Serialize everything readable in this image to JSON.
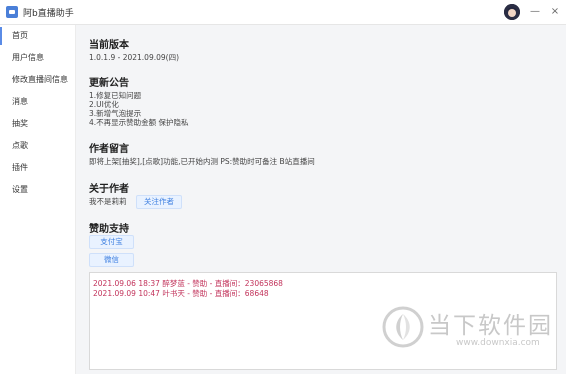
{
  "window": {
    "title": "阿b直播助手",
    "minimize": "—",
    "close": "×"
  },
  "sidebar": {
    "items": [
      {
        "label": "首页"
      },
      {
        "label": "用户信息"
      },
      {
        "label": "修改直播间信息"
      },
      {
        "label": "消息"
      },
      {
        "label": "抽奖"
      },
      {
        "label": "点歌"
      },
      {
        "label": "插件"
      },
      {
        "label": "设置"
      }
    ]
  },
  "main": {
    "version": {
      "title": "当前版本",
      "text": "1.0.1.9 - 2021.09.09(四)"
    },
    "notice": {
      "title": "更新公告",
      "lines": [
        "1.修复已知问题",
        "2.UI优化",
        "3.新增气泡提示",
        "4.不再显示赞助金额 保护隐私"
      ]
    },
    "author_msg": {
      "title": "作者留言",
      "text": "即将上架[抽奖],[点歌]功能,已开始内测  PS:赞助时可备注 B站直播间"
    },
    "about": {
      "title": "关于作者",
      "name": "我不是莉莉",
      "follow_button": "关注作者"
    },
    "support": {
      "title": "赞助支持",
      "alipay_button": "支付宝",
      "wechat_button": "微信"
    },
    "log": [
      "2021.09.06 18:37 醉梦蓝 - 赞助 - 直播间：23065868",
      "2021.09.09 10:47 叶书天 - 赞助 - 直播间：68648"
    ]
  },
  "watermark": {
    "text": "当下软件园",
    "url": "www.downxia.com"
  },
  "colors": {
    "accent": "#3d7fe0",
    "log_text": "#c2335b",
    "background": "#f4f5f7"
  }
}
